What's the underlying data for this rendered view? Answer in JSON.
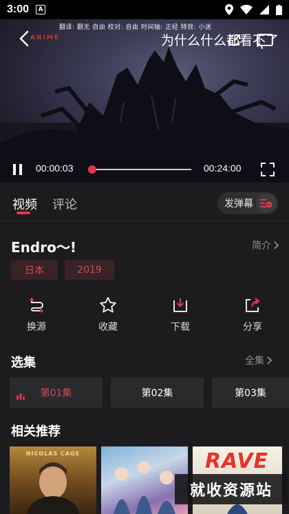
{
  "status_bar": {
    "time": "3:00",
    "notification_badge": "A"
  },
  "player": {
    "subtitle_credits": "翻译: 翻无 自由  校对: 自由  时间轴: 正经  特效: 小迷",
    "logo_text": "ANIME",
    "danmaku_text": "为什么什么都看不了",
    "current_time": "00:00:03",
    "total_time": "00:24:00",
    "progress_fraction": 0.012
  },
  "tabs": {
    "video": "视频",
    "comment": "评论",
    "danmaku_button": "发弹幕"
  },
  "info": {
    "title": "Endro～!",
    "intro_link": "简介",
    "tags": [
      "日本",
      "2019"
    ]
  },
  "actions": [
    {
      "label": "换源",
      "icon": "switch-source-icon"
    },
    {
      "label": "收藏",
      "icon": "star-icon"
    },
    {
      "label": "下载",
      "icon": "download-icon"
    },
    {
      "label": "分享",
      "icon": "share-icon"
    }
  ],
  "episodes": {
    "title": "选集",
    "all_link": "全集",
    "items": [
      "第01集",
      "第02集",
      "第03集"
    ],
    "active_index": 0
  },
  "recommend": {
    "title": "相关推荐",
    "posters": [
      {
        "caption": "NICOLAS CAGE"
      },
      {
        "caption": ""
      },
      {
        "caption": "RAVE"
      }
    ],
    "watermark": "就收资源站"
  },
  "colors": {
    "accent": "#e0364f",
    "background": "#1c1c1e",
    "tag_bg": "#3a2226"
  }
}
